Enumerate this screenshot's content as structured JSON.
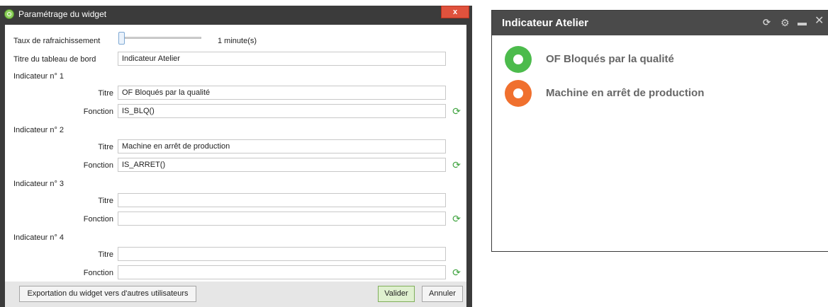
{
  "dialog": {
    "title": "Paramétrage du widget",
    "close_label": "x",
    "refresh_rate_label": "Taux de rafraichissement",
    "refresh_rate_value": "1 minute(s)",
    "dashboard_title_label": "Titre du tableau de bord",
    "dashboard_title_value": "Indicateur Atelier",
    "title_label": "Titre",
    "function_label": "Fonction",
    "indicators": [
      {
        "heading": "Indicateur n° 1",
        "title_value": "OF Bloqués par la qualité",
        "function_value": "IS_BLQ()"
      },
      {
        "heading": "Indicateur n° 2",
        "title_value": "Machine en arrêt de production",
        "function_value": "IS_ARRET()"
      },
      {
        "heading": "Indicateur n° 3",
        "title_value": "",
        "function_value": ""
      },
      {
        "heading": "Indicateur n° 4",
        "title_value": "",
        "function_value": ""
      }
    ],
    "export_label": "Exportation du widget vers d'autres utilisateurs",
    "validate_label": "Valider",
    "cancel_label": "Annuler"
  },
  "widget": {
    "title": "Indicateur Atelier",
    "header_icons": [
      "refresh-icon",
      "gear-icon",
      "maximize-icon",
      "close-icon"
    ],
    "indicators": [
      {
        "label": "OF Bloqués par la qualité",
        "color": "#4cbb4c"
      },
      {
        "label": "Machine en arrêt de production",
        "color": "#f0702e"
      }
    ]
  },
  "colors": {
    "titlebar": "#3b3b3b",
    "close_button": "#e0523d",
    "refresh_green": "#3ea33e",
    "widget_header": "#4a4a4a"
  }
}
